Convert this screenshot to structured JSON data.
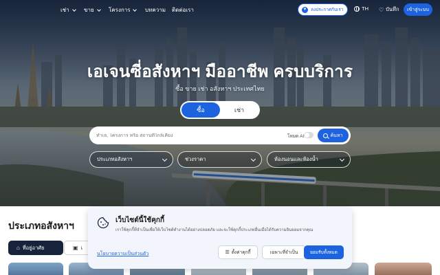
{
  "colors": {
    "brand_blue": "#1d63e0",
    "dark_navy": "#16233a",
    "cookie_bg": "#f2f6fc"
  },
  "nav": {
    "items": [
      {
        "label": "เช่า",
        "has_dropdown": true
      },
      {
        "label": "ขาย",
        "has_dropdown": true
      },
      {
        "label": "โครงการ",
        "has_dropdown": true
      },
      {
        "label": "บทความ",
        "has_dropdown": false
      },
      {
        "label": "ติดต่อเรา",
        "has_dropdown": false
      }
    ],
    "post_listing": "ลงประกาศกับเรา",
    "post_icon": "megaphone-icon",
    "language": "TH",
    "language_icon": "globe-icon",
    "saved": "บันทึก",
    "saved_icon": "heart-icon",
    "login": "เข้าสู่ระบบ"
  },
  "hero": {
    "headline": "เอเจนซี่อสังหาฯ มืออาชีพ ครบบริการ",
    "subline": "ซื้อ ขาย เช่า อสังหาฯ ประเทศไทย",
    "toggle": {
      "options": [
        "ซื้อ",
        "เช่า"
      ],
      "selected": "ซื้อ"
    },
    "search": {
      "placeholder": "ทำเล, โครงการ หรือ สถานที่ใกล้เคียง",
      "ai_mode_label": "โหมด AI",
      "ai_mode_on": false,
      "button_label": "ค้นหา",
      "button_icon": "search-icon"
    },
    "filters": [
      {
        "label": "ประเภทอสังหาฯ",
        "icon": "chevron-down-icon"
      },
      {
        "label": "ช่วงราคา",
        "icon": "chevron-down-icon"
      },
      {
        "label": "ห้องนอนและห้องน้ำ",
        "icon": "chevron-down-icon"
      }
    ]
  },
  "section": {
    "title": "ประเภทอสังหาฯ",
    "tabs": [
      {
        "label": "ที่อยู่อาศัย",
        "icon": "house-icon",
        "active": true
      },
      {
        "label": "เ",
        "icon": "store-icon",
        "active": false
      }
    ]
  },
  "cookie_banner": {
    "icon": "cookie-icon",
    "title": "เว็บไซต์นี้ใช้คุกกี้",
    "body": "เราใช้คุกกี้ที่จำเป็นเพื่อให้เว็บไซต์ทำงานได้อย่างปลอดภัย และจะใช้คุกกี้ประเภทอื่นเมื่อได้รับความยินยอมจากคุณ",
    "policy_link": "นโยบายความเป็นส่วนตัว",
    "settings_button": "ตั้งค่าคุกกี้",
    "settings_icon": "sliders-icon",
    "necessary_button": "เฉพาะที่จำเป็น",
    "accept_button": "ยอมรับทั้งหมด"
  }
}
